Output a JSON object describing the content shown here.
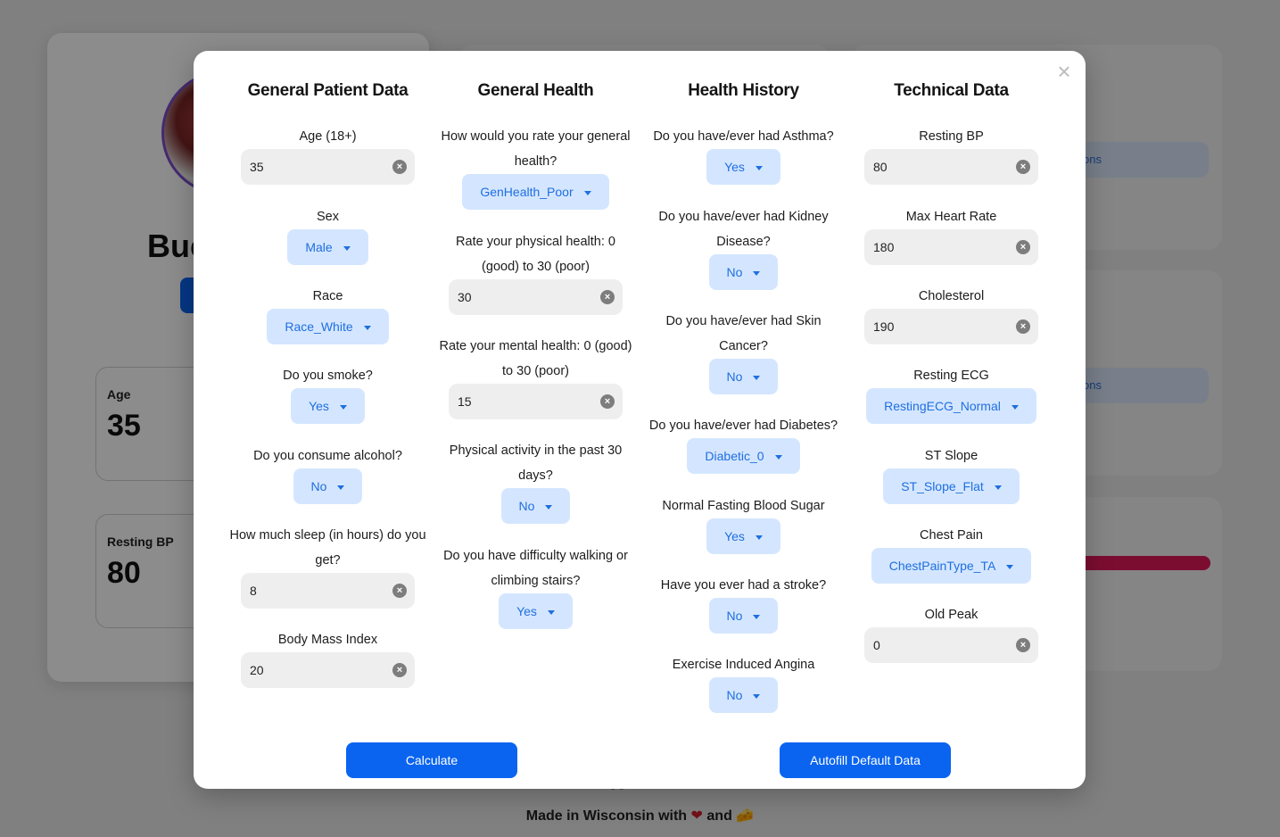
{
  "background": {
    "profile_name": "Buc",
    "stats": [
      {
        "label": "Age",
        "value": "35"
      },
      {
        "label": "Resting BP",
        "value": "80"
      }
    ],
    "pill_text": "ons",
    "footer_toggle": "Toggle Theme",
    "footer_made_prefix": "Made in Wisconsin with",
    "footer_made_and": "and",
    "footer_heart": "❤",
    "footer_cheese": "🧀"
  },
  "modal": {
    "close_symbol": "×",
    "columns": {
      "general_patient": {
        "title": "General Patient Data",
        "age": {
          "label": "Age (18+)",
          "value": "35"
        },
        "sex": {
          "label": "Sex",
          "value": "Male"
        },
        "race": {
          "label": "Race",
          "value": "Race_White"
        },
        "smoke": {
          "label": "Do you smoke?",
          "value": "Yes"
        },
        "alcohol": {
          "label": "Do you consume alcohol?",
          "value": "No"
        },
        "sleep": {
          "label": "How much sleep (in hours) do you get?",
          "value": "8"
        },
        "bmi": {
          "label": "Body Mass Index",
          "value": "20"
        }
      },
      "general_health": {
        "title": "General Health",
        "gen_health": {
          "label": "How would you rate your general health?",
          "value": "GenHealth_Poor"
        },
        "physical": {
          "label": "Rate your physical health: 0 (good) to 30 (poor)",
          "value": "30"
        },
        "mental": {
          "label": "Rate your mental health: 0 (good) to 30 (poor)",
          "value": "15"
        },
        "activity": {
          "label": "Physical activity in the past 30 days?",
          "value": "No"
        },
        "walking": {
          "label": "Do you have difficulty walking or climbing stairs?",
          "value": "Yes"
        }
      },
      "health_history": {
        "title": "Health History",
        "asthma": {
          "label": "Do you have/ever had Asthma?",
          "value": "Yes"
        },
        "kidney": {
          "label": "Do you have/ever had Kidney Disease?",
          "value": "No"
        },
        "skin": {
          "label": "Do you have/ever had Skin Cancer?",
          "value": "No"
        },
        "diabetes": {
          "label": "Do you have/ever had Diabetes?",
          "value": "Diabetic_0"
        },
        "fasting": {
          "label": "Normal Fasting Blood Sugar",
          "value": "Yes"
        },
        "stroke": {
          "label": "Have you ever had a stroke?",
          "value": "No"
        },
        "angina": {
          "label": "Exercise Induced Angina",
          "value": "No"
        }
      },
      "technical": {
        "title": "Technical Data",
        "resting_bp": {
          "label": "Resting BP",
          "value": "80"
        },
        "max_hr": {
          "label": "Max Heart Rate",
          "value": "180"
        },
        "cholesterol": {
          "label": "Cholesterol",
          "value": "190"
        },
        "resting_ecg": {
          "label": "Resting ECG",
          "value": "RestingECG_Normal"
        },
        "st_slope": {
          "label": "ST Slope",
          "value": "ST_Slope_Flat"
        },
        "chest_pain": {
          "label": "Chest Pain",
          "value": "ChestPainType_TA"
        },
        "old_peak": {
          "label": "Old Peak",
          "value": "0"
        }
      }
    },
    "calculate_label": "Calculate",
    "autofill_label": "Autofill Default Data",
    "clear_symbol": "×"
  },
  "colors": {
    "primary": "#0a64f0",
    "select_bg": "#d4e6ff",
    "select_text": "#1f6fe0",
    "input_bg": "#eeeeee",
    "danger_bar": "#e0195a"
  }
}
